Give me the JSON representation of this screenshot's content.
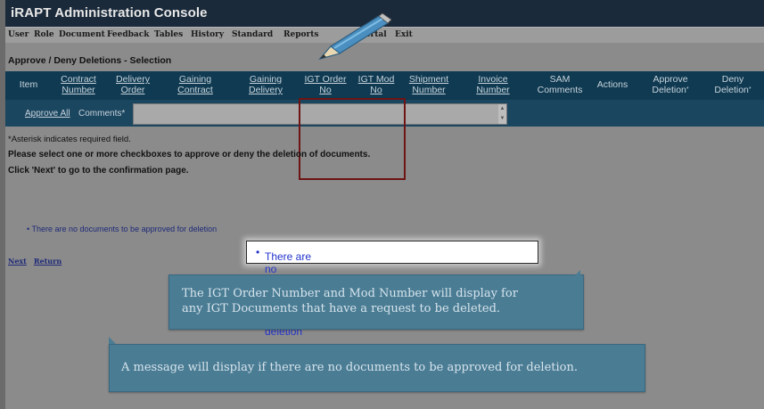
{
  "app": {
    "title": "iRAPT Administration Console"
  },
  "menu": [
    "User",
    "Role",
    "Document",
    "Feedback",
    "Tables",
    "History",
    "Standard",
    "Reports",
    "",
    "Portal",
    "Exit"
  ],
  "page": {
    "title": "Approve / Deny Deletions - Selection"
  },
  "table": {
    "headers": [
      {
        "l1": "Item",
        "l2": ""
      },
      {
        "l1": "Contract",
        "l2": "Number"
      },
      {
        "l1": "Delivery",
        "l2": "Order"
      },
      {
        "l1": "Gaining",
        "l2": "Contract"
      },
      {
        "l1": "Gaining",
        "l2": "Delivery"
      },
      {
        "l1": "IGT Order",
        "l2": "No"
      },
      {
        "l1": "IGT Mod",
        "l2": "No"
      },
      {
        "l1": "Shipment",
        "l2": "Number"
      },
      {
        "l1": "Invoice",
        "l2": "Number"
      },
      {
        "l1": "SAM",
        "l2": "Comments"
      },
      {
        "l1": "Actions",
        "l2": ""
      },
      {
        "l1": "Approve",
        "l2": "Deletion"
      },
      {
        "l1": "Deny",
        "l2": "Deletion"
      }
    ],
    "asterisk": "*",
    "approve_all": "Approve All",
    "comments_label": "Comments",
    "comments_value": ""
  },
  "info": {
    "asterisk_note": "*Asterisk indicates required field.",
    "instruction": "Please select one or more checkboxes to approve or deny the deletion of documents.",
    "next_note": "Click 'Next' to go to the confirmation page.",
    "no_docs": "There are no documents to be approved for deletion"
  },
  "links": {
    "next": "Next",
    "return": "Return"
  },
  "highlight": {
    "text": "There are no documents to be approved for deletion"
  },
  "callouts": {
    "igt_line1": "The IGT Order Number and Mod Number will display for",
    "igt_line2": "any IGT Documents that have a request to be deleted.",
    "message": "A message will display if there are no documents to be approved for deletion."
  },
  "colors": {
    "header": "#0f3a52",
    "callout": "#4a7c94",
    "highlight_box": "#6e1414",
    "link": "#2233cc"
  },
  "icons": {
    "pencil": "pencil-icon"
  }
}
